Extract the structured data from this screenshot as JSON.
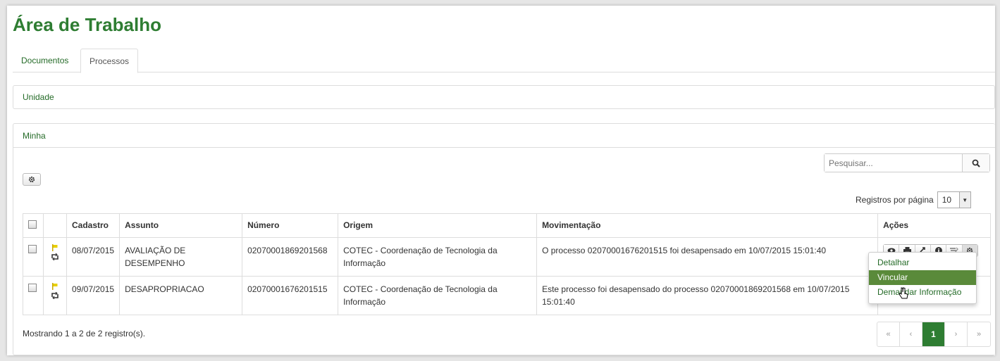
{
  "page_title": "Área de Trabalho",
  "tabs": [
    "Documentos",
    "Processos"
  ],
  "panels": {
    "unit": "Unidade",
    "mine": "Minha"
  },
  "search": {
    "placeholder": "Pesquisar..."
  },
  "per_page": {
    "label": "Registros por página",
    "value": "10"
  },
  "table": {
    "headers": [
      "Cadastro",
      "Assunto",
      "Número",
      "Origem",
      "Movimentação",
      "Ações"
    ],
    "rows": [
      {
        "cadastro": "08/07/2015",
        "assunto": "AVALIAÇÃO DE DESEMPENHO",
        "numero": "02070001869201568",
        "origem": "COTEC - Coordenação de Tecnologia da Informação",
        "movimentacao": "O processo 02070001676201515 foi desapensado em 10/07/2015 15:01:40"
      },
      {
        "cadastro": "09/07/2015",
        "assunto": "DESAPROPRIACAO",
        "numero": "02070001676201515",
        "origem": "COTEC - Coordenação de Tecnologia da Informação",
        "movimentacao": "Este processo foi desapensado do processo 02070001869201568 em 10/07/2015 15:01:40"
      }
    ]
  },
  "dropdown": [
    "Detalhar",
    "Vincular",
    "Demandar Informação"
  ],
  "footer": "Mostrando 1 a 2 de 2 registro(s).",
  "pager": {
    "first": "«",
    "prev": "‹",
    "current": "1",
    "next": "›",
    "last": "»"
  },
  "colors": {
    "accent": "#2e7d32",
    "active_menu": "#5a8a3a"
  }
}
